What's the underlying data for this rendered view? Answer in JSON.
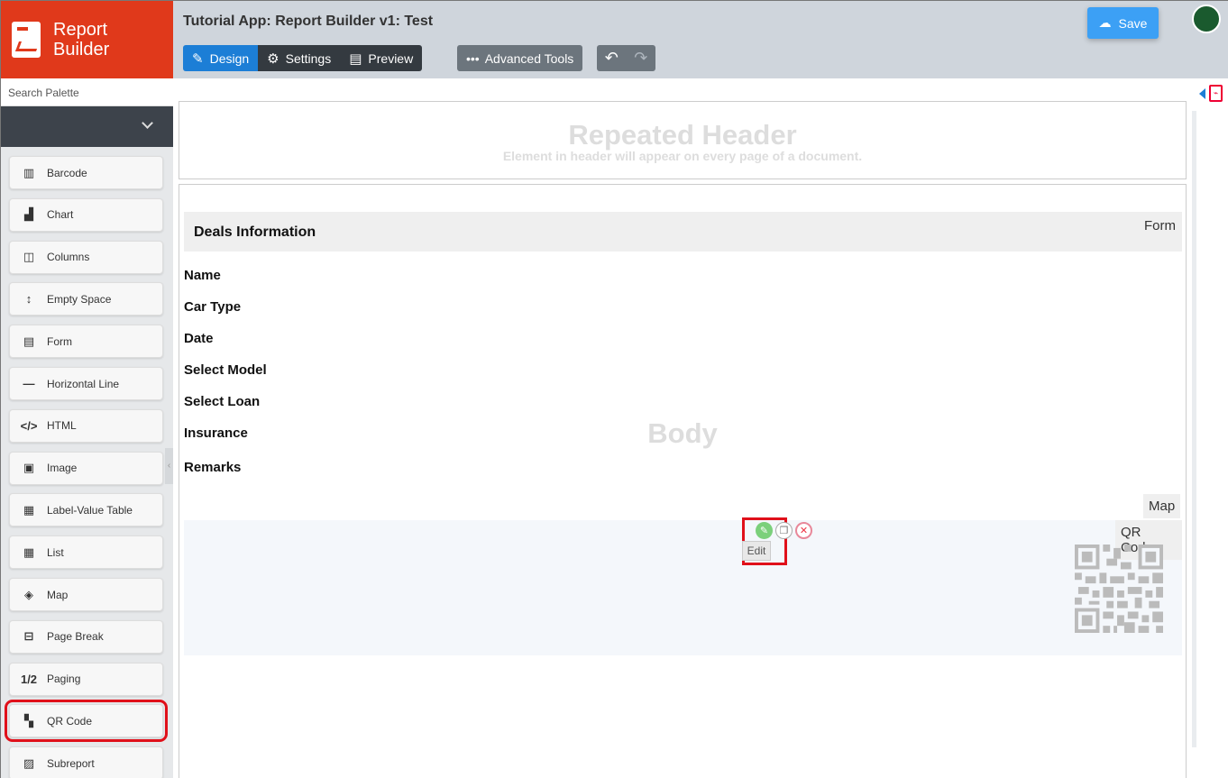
{
  "brand": {
    "name_line1": "Report",
    "name_line2": "Builder"
  },
  "sidebar": {
    "search_placeholder": "Search Palette",
    "items": [
      {
        "label": "Barcode",
        "icon": "barcode-icon",
        "glyph": "▥"
      },
      {
        "label": "Chart",
        "icon": "chart-icon",
        "glyph": "▟"
      },
      {
        "label": "Columns",
        "icon": "columns-icon",
        "glyph": "◫"
      },
      {
        "label": "Empty Space",
        "icon": "vertical-arrows-icon",
        "glyph": "↕"
      },
      {
        "label": "Form",
        "icon": "document-icon",
        "glyph": "▤"
      },
      {
        "label": "Horizontal Line",
        "icon": "horizontal-line-icon",
        "glyph": "—"
      },
      {
        "label": "HTML",
        "icon": "code-icon",
        "glyph": "</>"
      },
      {
        "label": "Image",
        "icon": "image-icon",
        "glyph": "▣"
      },
      {
        "label": "Label-Value Table",
        "icon": "table-icon",
        "glyph": "▦"
      },
      {
        "label": "List",
        "icon": "list-icon",
        "glyph": "▦"
      },
      {
        "label": "Map",
        "icon": "map-icon",
        "glyph": "◈"
      },
      {
        "label": "Page Break",
        "icon": "page-break-icon",
        "glyph": "⊟"
      },
      {
        "label": "Paging",
        "icon": "paging-icon",
        "glyph": "1/2"
      },
      {
        "label": "QR Code",
        "icon": "qr-code-icon",
        "glyph": "▚"
      },
      {
        "label": "Subreport",
        "icon": "subreport-icon",
        "glyph": "▨"
      }
    ],
    "highlighted_item": "QR Code"
  },
  "toolbar": {
    "app_title": "Tutorial App: Report Builder v1: Test",
    "design": "Design",
    "settings": "Settings",
    "preview": "Preview",
    "advanced": "Advanced Tools",
    "save": "Save",
    "active_tab": "Design"
  },
  "canvas": {
    "header_title": "Repeated Header",
    "header_subtitle": "Element in header will appear on every page of a document.",
    "body_label": "Body",
    "form_title": "Deals Information",
    "form_tag": "Form",
    "fields": [
      "Name",
      "Car Type",
      "Date",
      "Select Model",
      "Select Loan",
      "Insurance",
      "Remarks"
    ],
    "map_tag": "Map",
    "qr_tag": "QR Code",
    "tooltip": "Edit"
  },
  "colors": {
    "brand": "#e0391b",
    "accent": "#1c7ed6",
    "highlight": "#e0101a"
  }
}
